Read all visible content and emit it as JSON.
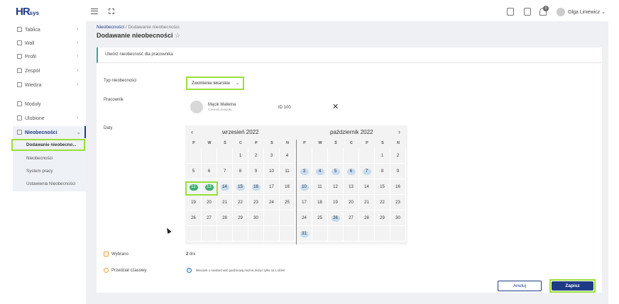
{
  "header": {
    "logo_main": "HR",
    "logo_sub": "sys",
    "notif_count": "0",
    "user_name": "Olga Liniewicz ⌄"
  },
  "sidebar": {
    "items": [
      {
        "label": "Tablica",
        "chevron": "›"
      },
      {
        "label": "Wall",
        "chevron": "›"
      },
      {
        "label": "Profil",
        "chevron": "›"
      },
      {
        "label": "Zespół",
        "chevron": "›"
      },
      {
        "label": "Wiedza",
        "chevron": "›"
      },
      {
        "label": "Moduły",
        "chevron": ""
      },
      {
        "label": "Ulubione",
        "chevron": "›"
      },
      {
        "label": "Nieobecności",
        "chevron": "⌄"
      }
    ],
    "sub_items": [
      "Dodawanie nieobecno...",
      "Nieobecności",
      "System pracy",
      "Ustawienia Nieobecności"
    ]
  },
  "breadcrumb": {
    "root": "Nieobecności",
    "sep": " / ",
    "current": "Dodawanie nieobecności"
  },
  "page_title": "Dodawanie nieobecności",
  "star": "☆",
  "form": {
    "card_title": "Utwórz nieobecność dla pracownika",
    "type_label": "Typ nieobecności",
    "type_value": "Zwolnienie lekarskie",
    "employee_label": "Pracownik",
    "employee_name": "Mącik Malwina",
    "employee_role": "Członek Zespołu",
    "employee_id": "ID 100",
    "remove_glyph": "✕",
    "dates_label": "Daty",
    "selected_label": "Wybrano",
    "selected_value": "2",
    "selected_unit": " dni",
    "period_label": "Przedział czasowy",
    "info_icon": "i",
    "period_info": "Wniosek o nieobecność godzinową można złożyć tylko na 1 dzień",
    "cancel_label": "Anuluj",
    "save_label": "Zapisz"
  },
  "calendar": {
    "prev": "‹",
    "next": "›",
    "weekdays": [
      "P",
      "W",
      "Ś",
      "C",
      "P",
      "S",
      "N"
    ],
    "months": [
      {
        "title": "wrzesień 2022",
        "weeks": [
          [
            "",
            "",
            "",
            "1",
            "2",
            "3",
            "4"
          ],
          [
            "5",
            "6",
            "7",
            "8",
            "9",
            "10",
            "11"
          ],
          [
            "12",
            "13",
            "14",
            "15",
            "16",
            "17",
            "18"
          ],
          [
            "19",
            "20",
            "21",
            "22",
            "23",
            "24",
            "25"
          ],
          [
            "26",
            "27",
            "28",
            "29",
            "30",
            "",
            ""
          ],
          [
            "",
            "",
            "",
            "",
            "",
            "",
            ""
          ]
        ],
        "selected": [
          "12",
          "13"
        ],
        "marked": [
          "14",
          "15",
          "16"
        ]
      },
      {
        "title": "październik 2022",
        "weeks": [
          [
            "",
            "",
            "",
            "",
            "",
            "1",
            "2"
          ],
          [
            "3",
            "4",
            "5",
            "6",
            "7",
            "8",
            "9"
          ],
          [
            "10",
            "11",
            "12",
            "13",
            "14",
            "15",
            "16"
          ],
          [
            "17",
            "18",
            "19",
            "20",
            "21",
            "22",
            "23"
          ],
          [
            "24",
            "25",
            "26",
            "27",
            "28",
            "29",
            "30"
          ],
          [
            "31",
            "",
            "",
            "",
            "",
            "",
            ""
          ]
        ],
        "selected": [],
        "marked": [
          "3",
          "4",
          "5",
          "6",
          "7",
          "10",
          "26",
          "31"
        ]
      }
    ]
  },
  "colors": {
    "accent": "#1f3b86",
    "selected": "#3fae74",
    "range": "#c7dcf0",
    "highlight": "#9adf3a"
  }
}
